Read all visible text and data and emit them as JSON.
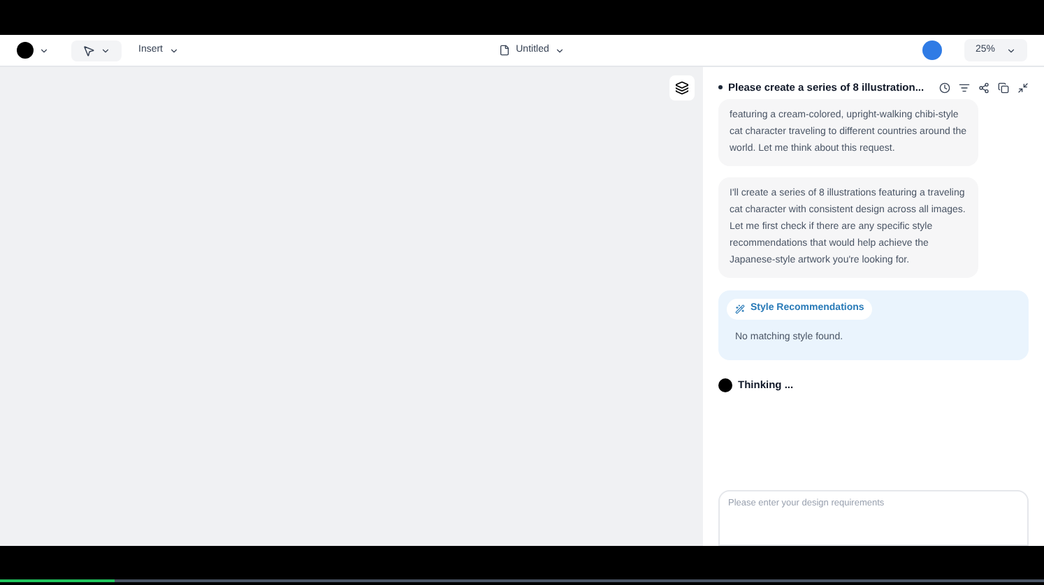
{
  "toolbar": {
    "insert_label": "Insert",
    "document_title": "Untitled",
    "zoom": "25%"
  },
  "chat": {
    "title": "Please create a series of 8 illustration...",
    "messages": [
      {
        "text": "featuring a cream-colored, upright-walking chibi-style cat character traveling to different countries around the world. Let me think about this request."
      },
      {
        "text": "I'll create a series of 8 illustrations featuring a traveling cat character with consistent design across all images. Let me first check if there are any specific style recommendations that would help achieve the Japanese-style artwork you're looking for."
      }
    ],
    "tool_card": {
      "label": "Style Recommendations",
      "result": "No matching style found."
    },
    "status": "Thinking ...",
    "input": {
      "placeholder": "Please enter your design requirements"
    }
  },
  "video": {
    "level": 0.11
  }
}
